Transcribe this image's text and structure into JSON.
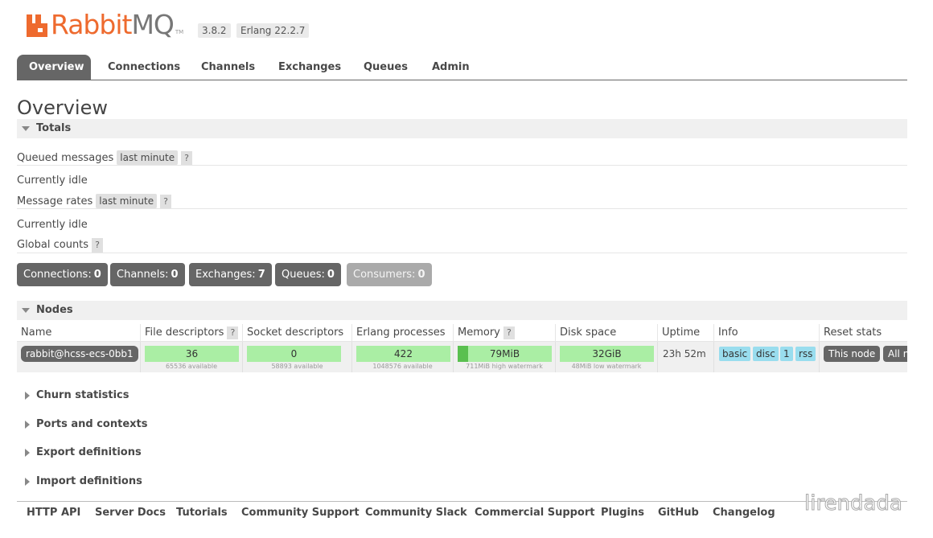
{
  "header": {
    "logo_rabbit": "Rabbit",
    "logo_mq": "MQ",
    "logo_tm": "TM",
    "version": "3.8.2",
    "erlang": "Erlang 22.2.7"
  },
  "tabs": [
    {
      "label": "Overview",
      "active": true
    },
    {
      "label": "Connections"
    },
    {
      "label": "Channels"
    },
    {
      "label": "Exchanges"
    },
    {
      "label": "Queues"
    },
    {
      "label": "Admin"
    }
  ],
  "page_title": "Overview",
  "totals": {
    "section_label": "Totals",
    "queued_messages_label": "Queued messages",
    "queued_messages_range": "last minute",
    "help": "?",
    "idle_1": "Currently idle",
    "message_rates_label": "Message rates",
    "message_rates_range": "last minute",
    "idle_2": "Currently idle",
    "global_counts_label": "Global counts"
  },
  "counts": [
    {
      "label": "Connections:",
      "value": "0"
    },
    {
      "label": "Channels:",
      "value": "0"
    },
    {
      "label": "Exchanges:",
      "value": "7"
    },
    {
      "label": "Queues:",
      "value": "0"
    },
    {
      "label": "Consumers:",
      "value": "0"
    }
  ],
  "nodes": {
    "section_label": "Nodes",
    "columns": [
      "Name",
      "File descriptors",
      "Socket descriptors",
      "Erlang processes",
      "Memory",
      "Disk space",
      "Uptime",
      "Info",
      "Reset stats"
    ],
    "row": {
      "name": "rabbit@hcss-ecs-0bb1",
      "file_descriptors": "36",
      "file_descriptors_sub": "65536 available",
      "socket_descriptors": "0",
      "socket_descriptors_sub": "58893 available",
      "erlang_processes": "422",
      "erlang_processes_sub": "1048576 available",
      "memory": "79MiB",
      "memory_sub": "711MiB high watermark",
      "memory_fraction": 0.11,
      "disk_space": "32GiB",
      "disk_space_sub": "48MiB low watermark",
      "uptime": "23h 52m",
      "info": [
        "basic",
        "disc",
        "1",
        "rss"
      ],
      "reset_this_node": "This node",
      "reset_all_nodes": "All nodes"
    }
  },
  "collapsed_sections": [
    "Churn statistics",
    "Ports and contexts",
    "Export definitions",
    "Import definitions"
  ],
  "footer_links": [
    "HTTP API",
    "Server Docs",
    "Tutorials",
    "Community Support",
    "Community Slack",
    "Commercial Support",
    "Plugins",
    "GitHub",
    "Changelog"
  ],
  "watermark": "lirendada",
  "colors": {
    "brand_orange": "#ee6a2e",
    "tab_active": "#666666",
    "bar_green": "#aaeea4",
    "bar_fill_dark": "#5ac050",
    "info_blue": "#99ddee"
  }
}
